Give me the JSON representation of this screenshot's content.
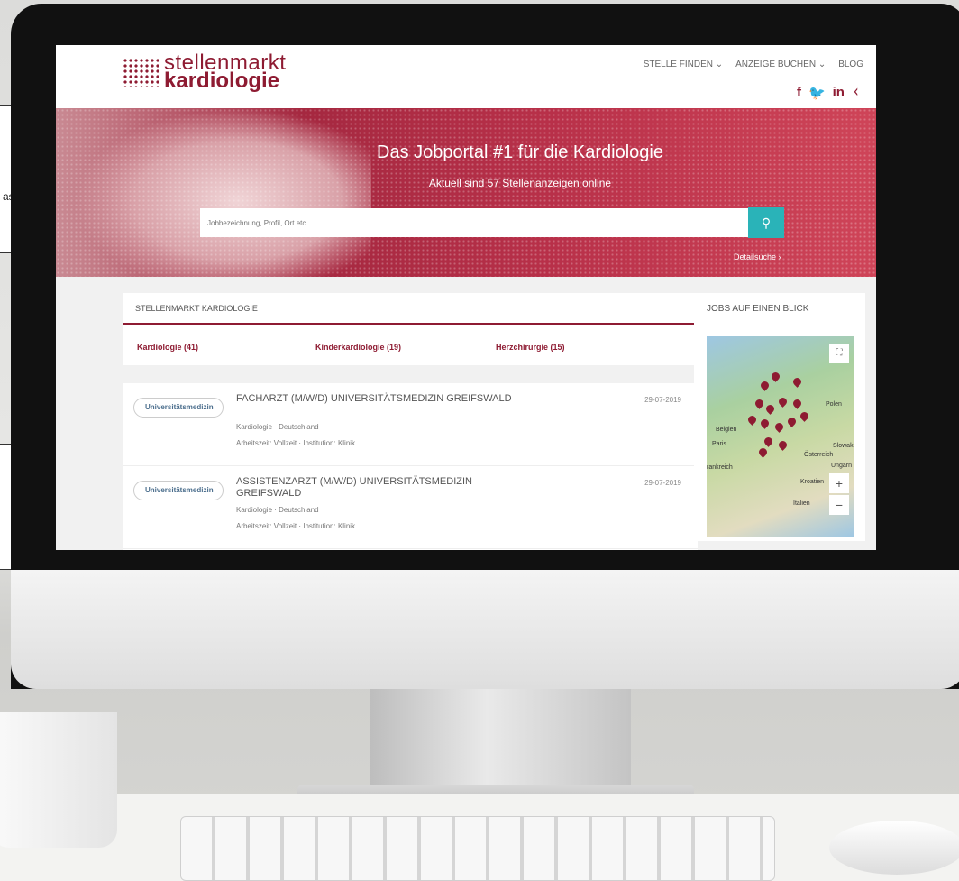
{
  "left_note": "as",
  "header": {
    "logo_line1": "stellenmarkt",
    "logo_line2": "kardiologie",
    "nav": [
      "STELLE FINDEN ⌄",
      "ANZEIGE BUCHEN ⌄",
      "BLOG"
    ],
    "social": [
      "f",
      "🐦",
      "in",
      "ᚲ"
    ]
  },
  "hero": {
    "title": "Das Jobportal #1 für die Kardiologie",
    "subtitle": "Aktuell sind 57 Stellenanzeigen online",
    "search_placeholder": "Jobbezeichnung, Profil, Ort etc",
    "search_icon": "search-icon",
    "detail_link": "Detailsuche ›"
  },
  "categories": {
    "heading": "STELLENMARKT KARDIOLOGIE",
    "items": [
      "Kardiologie (41)",
      "Kinderkardiologie (19)",
      "Herzchirurgie (15)"
    ]
  },
  "jobs": [
    {
      "logo": "Universitätsmedizin",
      "title": "FACHARZT (M/W/D) UNIVERSITÄTSMEDIZIN GREIFSWALD",
      "date": "29-07-2019",
      "meta1": "Kardiologie  ·  Deutschland",
      "meta2": "Arbeitszeit: Vollzeit  ·  Institution: Klinik"
    },
    {
      "logo": "Universitätsmedizin",
      "title": "ASSISTENZARZT (M/W/D) UNIVERSITÄTSMEDIZIN GREIFSWALD",
      "date": "29-07-2019",
      "meta1": "Kardiologie  ·  Deutschland",
      "meta2": "Arbeitszeit: Vollzeit  ·  Institution: Klinik"
    }
  ],
  "sidebar": {
    "heading": "JOBS AUF EINEN BLICK",
    "map_labels": [
      "Polen",
      "Belgien",
      "Paris",
      "rankreich",
      "Österreich",
      "Ungarn",
      "Kroatien",
      "Italien",
      "Slowak"
    ],
    "zoom_in": "+",
    "zoom_out": "−",
    "fullscreen": "⛶"
  },
  "colors": {
    "brand": "#8e1b32",
    "accent": "#2ab3b8"
  }
}
